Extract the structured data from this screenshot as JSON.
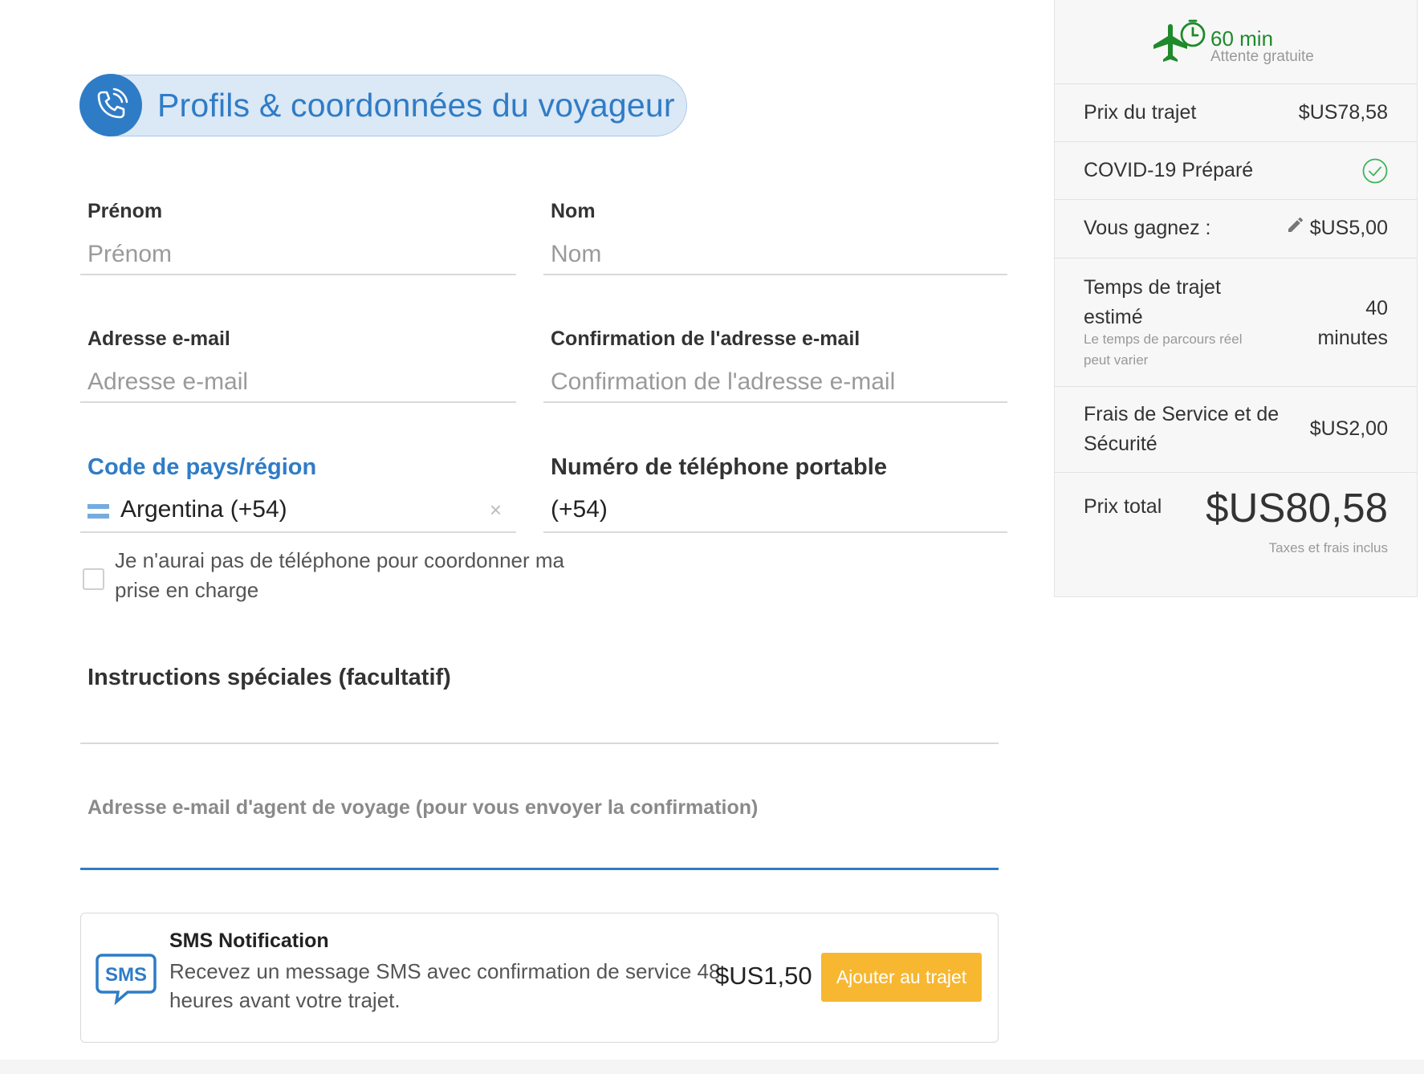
{
  "header": {
    "title": "Profils & coordonnées du voyageur"
  },
  "form": {
    "first_name": {
      "label": "Prénom",
      "placeholder": "Prénom",
      "value": ""
    },
    "last_name": {
      "label": "Nom",
      "placeholder": "Nom",
      "value": ""
    },
    "email": {
      "label": "Adresse e-mail",
      "placeholder": "Adresse e-mail",
      "value": ""
    },
    "email_confirm": {
      "label": "Confirmation de l'adresse e-mail",
      "placeholder": "Confirmation de l'adresse e-mail",
      "value": ""
    },
    "country": {
      "label": "Code de pays/région",
      "value": "Argentina (+54)",
      "clear_icon": "×"
    },
    "phone": {
      "label": "Numéro de téléphone portable",
      "value": "(+54)"
    },
    "no_phone": {
      "label": "Je n'aurai pas de téléphone pour coordonner ma prise en charge",
      "checked": false
    },
    "instructions": {
      "label": "Instructions spéciales (facultatif)",
      "value": ""
    },
    "agent_email": {
      "label": "Adresse e-mail d'agent de voyage (pour vous envoyer la confirmation)",
      "value": ""
    }
  },
  "sms": {
    "icon_text": "SMS",
    "title": "SMS Notification",
    "description": "Recevez un message SMS avec confirmation de service 48 heures avant votre trajet.",
    "price": "$US1,50",
    "button_label": "Ajouter au trajet"
  },
  "summary": {
    "wait": {
      "minutes": "60 min",
      "subtitle": "Attente gratuite"
    },
    "trip_price": {
      "label": "Prix du trajet",
      "value": "$US78,58"
    },
    "covid": {
      "label": "COVID-19 Préparé"
    },
    "earn": {
      "label": "Vous gagnez :",
      "value": "$US5,00"
    },
    "duration": {
      "label": "Temps de trajet estimé",
      "note": "Le temps de parcours réel peut varier",
      "value": "40 minutes"
    },
    "fees": {
      "label": "Frais de Service et de Sécurité",
      "value": "$US2,00"
    },
    "total": {
      "label": "Prix total",
      "value": "$US80,58",
      "note": "Taxes et frais inclus"
    }
  },
  "colors": {
    "accent": "#2f7cc6",
    "button": "#f7b731",
    "success": "#1e8a2b"
  },
  "icons": [
    "phone-icon",
    "clear-icon",
    "argentina-flag-icon",
    "sms-icon",
    "plane-icon",
    "stopwatch-icon",
    "check-circle-icon",
    "pencil-icon"
  ]
}
